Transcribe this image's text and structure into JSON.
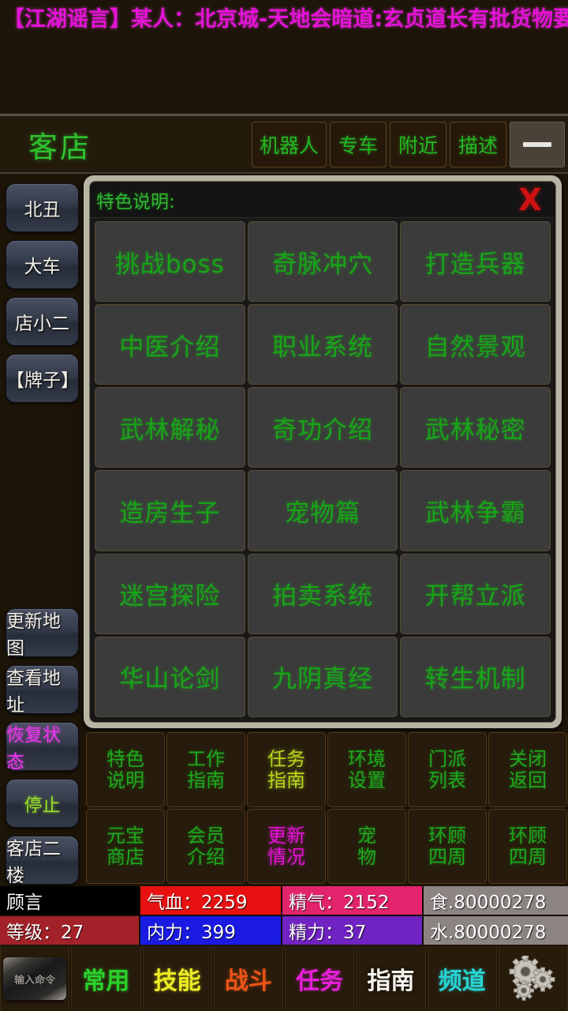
{
  "announcement": {
    "text": "【江湖谣言】某人：北京城-天地会暗道:玄贞道长有批货物要送到"
  },
  "header": {
    "room_title": "客店",
    "buttons": [
      {
        "label": "机器人",
        "name": "robot"
      },
      {
        "label": "专车",
        "name": "special-car"
      },
      {
        "label": "附近",
        "name": "nearby"
      },
      {
        "label": "描述",
        "name": "description"
      }
    ],
    "minimize_icon": "minimize-icon"
  },
  "sidebar": {
    "top_items": [
      {
        "label": "北丑",
        "color": "white"
      },
      {
        "label": "大车",
        "color": "white"
      },
      {
        "label": "店小二",
        "color": "white"
      },
      {
        "label": "【牌子】",
        "color": "white"
      }
    ],
    "bottom_items": [
      {
        "label": "更新地图",
        "color": "white"
      },
      {
        "label": "查看地址",
        "color": "white"
      },
      {
        "label": "恢复状态",
        "color": "magenta"
      },
      {
        "label": "停止",
        "color": "green"
      },
      {
        "label": "客店二楼",
        "color": "white"
      }
    ]
  },
  "modal": {
    "title": "特色说明:",
    "close_label": "X",
    "items": [
      "挑战boss",
      "奇脉冲穴",
      "打造兵器",
      "中医介绍",
      "职业系统",
      "自然景观",
      "武林解秘",
      "奇功介绍",
      "武林秘密",
      "造房生子",
      "宠物篇",
      "武林争霸",
      "迷宫探险",
      "拍卖系统",
      "开帮立派",
      "华山论剑",
      "九阴真经",
      "转生机制"
    ]
  },
  "command_menu": {
    "items": [
      {
        "line1": "特色",
        "line2": "说明",
        "style": "normal"
      },
      {
        "line1": "工作",
        "line2": "指南",
        "style": "normal"
      },
      {
        "line1": "任务",
        "line2": "指南",
        "style": "yellow"
      },
      {
        "line1": "环境",
        "line2": "设置",
        "style": "normal"
      },
      {
        "line1": "门派",
        "line2": "列表",
        "style": "normal"
      },
      {
        "line1": "关闭",
        "line2": "返回",
        "style": "normal"
      },
      {
        "line1": "元宝",
        "line2": "商店",
        "style": "normal"
      },
      {
        "line1": "会员",
        "line2": "介绍",
        "style": "normal"
      },
      {
        "line1": "更新",
        "line2": "情况",
        "style": "magenta"
      },
      {
        "line1": "宠",
        "line2": "物",
        "style": "normal"
      },
      {
        "line1": "环顾",
        "line2": "四周",
        "style": "normal"
      },
      {
        "line1": "环顾",
        "line2": "四周",
        "style": "normal"
      }
    ]
  },
  "status": {
    "row1": [
      {
        "text": "顾言",
        "name": "player-name"
      },
      {
        "text": "气血：2259",
        "name": "hp"
      },
      {
        "text": "精气：2152",
        "name": "qi"
      },
      {
        "text": "食.80000278",
        "name": "food"
      }
    ],
    "row2": [
      {
        "text": "等级：27",
        "name": "level"
      },
      {
        "text": "内力：399",
        "name": "mp"
      },
      {
        "text": "精力：37",
        "name": "energy"
      },
      {
        "text": "水.80000278",
        "name": "water"
      }
    ]
  },
  "toolbar": {
    "input_placeholder": "输入命令",
    "items": [
      {
        "label": "常用",
        "style": "green"
      },
      {
        "label": "技能",
        "style": "yellow"
      },
      {
        "label": "战斗",
        "style": "orange"
      },
      {
        "label": "任务",
        "style": "magenta"
      },
      {
        "label": "指南",
        "style": "white"
      },
      {
        "label": "频道",
        "style": "cyan"
      }
    ],
    "settings_icon": "gears-icon"
  },
  "colors": {
    "background": "#1d1509",
    "announce": "#e313d6",
    "green_text": "#2fc32f",
    "modal_frame": "#b9b5a4",
    "close_red": "#cf1111"
  }
}
